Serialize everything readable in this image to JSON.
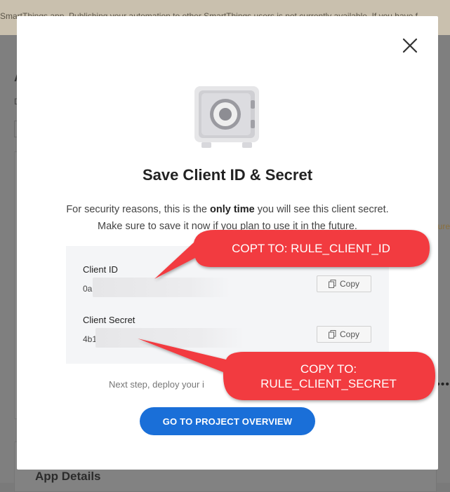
{
  "background": {
    "banner_text": "SmartThings app. Publishing your automation to other SmartThings users is not currently available. If you have f",
    "heading_letter": "A",
    "sub_letter": "D",
    "side_text": "ure",
    "dots": "•••",
    "footer_label": "App Details"
  },
  "modal": {
    "title": "Save Client ID & Secret",
    "description": {
      "part1": "For security reasons, this is the ",
      "bold": "only time",
      "part2": " you will see this client secret. Make sure to save it now if you plan to use it in the future."
    },
    "client_id": {
      "label": "Client ID",
      "value_visible": "0a",
      "copy_label": "Copy"
    },
    "client_secret": {
      "label": "Client Secret",
      "value_visible": "4b1",
      "copy_label": "Copy"
    },
    "next_step": "Next step, deploy your i",
    "primary_button": "GO TO PROJECT OVERVIEW"
  },
  "callouts": {
    "client_id": "COPT TO: RULE_CLIENT_ID",
    "client_secret_line1": "COPY TO:",
    "client_secret_line2": "RULE_CLIENT_SECRET"
  },
  "colors": {
    "accent": "#1a6fd8",
    "callout": "#f23a3f"
  }
}
